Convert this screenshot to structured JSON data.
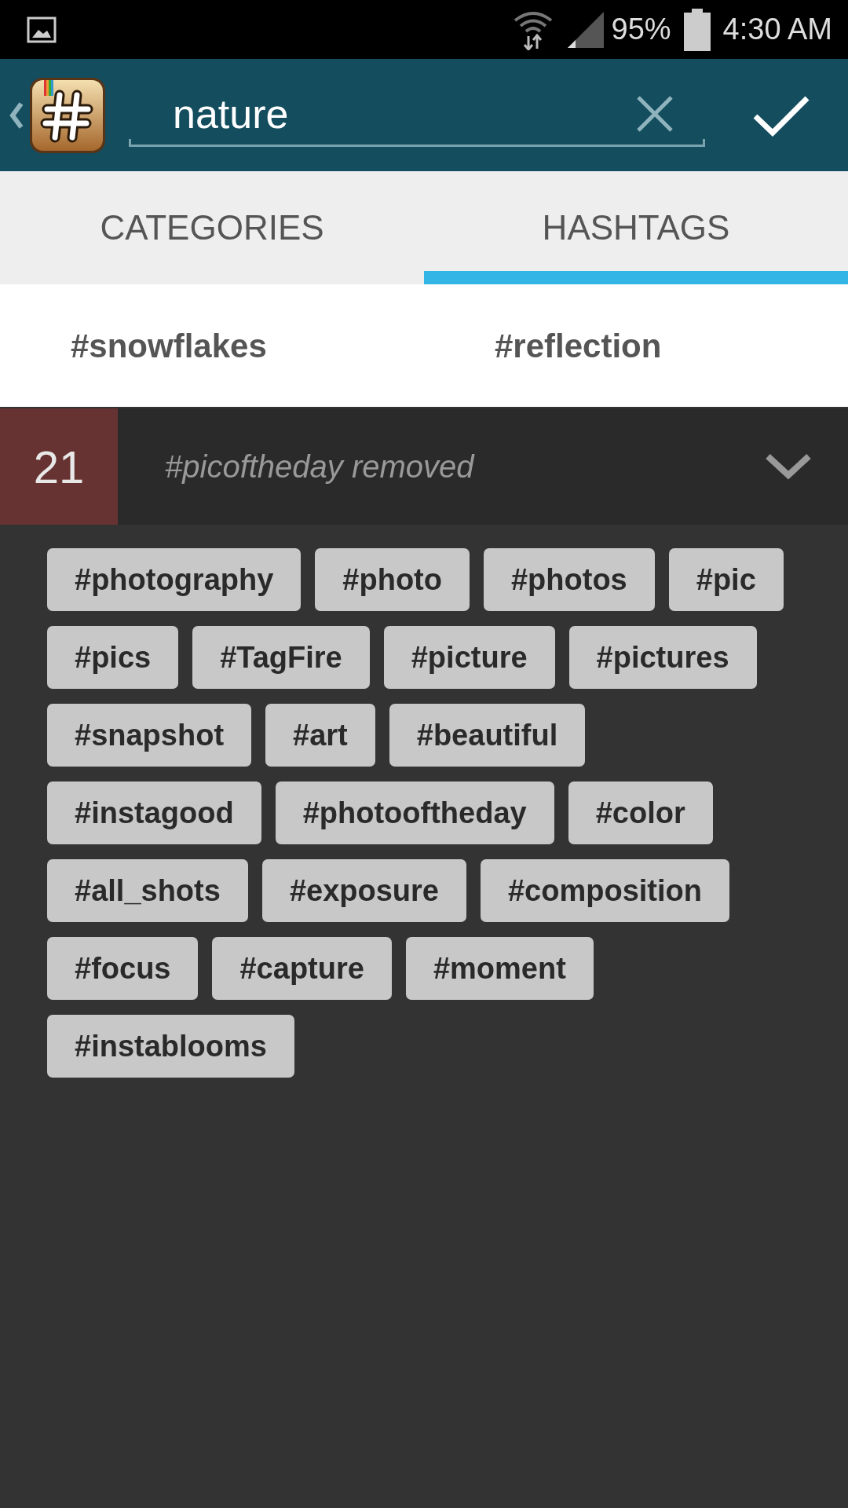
{
  "status_bar": {
    "battery": "95%",
    "time": "4:30 AM"
  },
  "search": {
    "value": "nature"
  },
  "tabs": [
    {
      "label": "CATEGORIES",
      "selected": false
    },
    {
      "label": "HASHTAGS",
      "selected": true
    }
  ],
  "suggestions": [
    "#snowflakes",
    "#reflection"
  ],
  "selection": {
    "count": "21",
    "message": "#picoftheday removed",
    "expanded": false
  },
  "tags": [
    "#photography",
    "#photo",
    "#photos",
    "#pic",
    "#pics",
    "#TagFire",
    "#picture",
    "#pictures",
    "#snapshot",
    "#art",
    "#beautiful",
    "#instagood",
    "#photooftheday",
    "#color",
    "#all_shots",
    "#exposure",
    "#composition",
    "#focus",
    "#capture",
    "#moment",
    "#instablooms"
  ]
}
